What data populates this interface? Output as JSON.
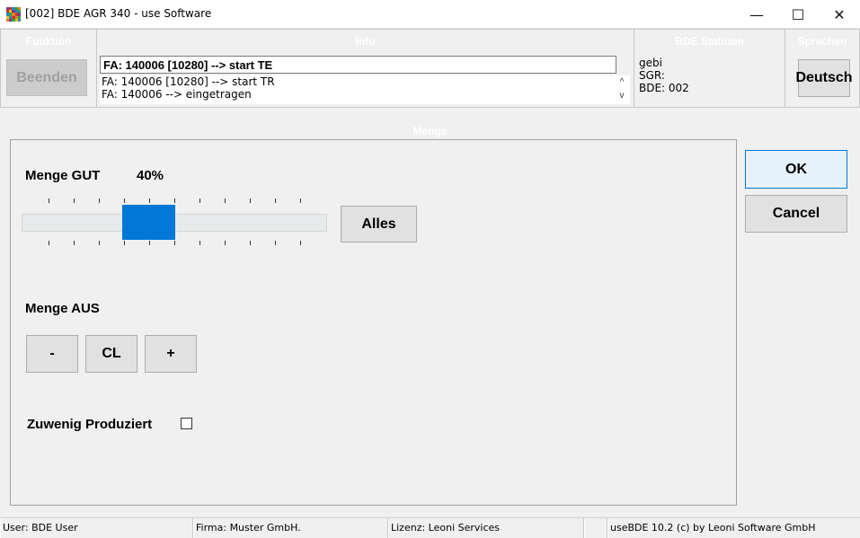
{
  "window": {
    "title": "[002] BDE AGR 340 - use Software",
    "minimize_glyph": "—",
    "maximize_glyph": "☐",
    "close_glyph": "✕"
  },
  "panels": {
    "funktion": {
      "title": "Funktion",
      "beenden_label": "Beenden"
    },
    "info": {
      "title": "Info",
      "current": "FA: 140006 [10280] --> start TE",
      "lines": [
        "FA: 140006 [10280] --> start TR",
        "FA: 140006 --> eingetragen"
      ],
      "scroll_up": "^",
      "scroll_down": "v"
    },
    "station": {
      "title": "BDE Statinon",
      "line1": "gebi",
      "line2": "SGR:",
      "line3": "BDE: 002"
    },
    "sprachen": {
      "title": "Sprachen",
      "language_label": "Deutsch"
    }
  },
  "menge": {
    "section_title": "Menge",
    "gut_label": "Menge GUT",
    "gut_percent": "40%",
    "gut_level": 0.4,
    "alles_label": "Alles",
    "aus_label": "Menge AUS",
    "minus_label": "-",
    "cl_label": "CL",
    "plus_label": "+",
    "zuwenig_label": "Zuwenig Produziert",
    "zuwenig_checked": false
  },
  "actions": {
    "ok_label": "OK",
    "cancel_label": "Cancel"
  },
  "status": {
    "user": "User: BDE User",
    "firma": "Firma: Muster GmbH.",
    "lizenz": "Lizenz: Leoni Services",
    "empty": "",
    "version": "useBDE 10.2 (c) by Leoni Software GmbH"
  },
  "colors": {
    "accent": "#0078d7",
    "panel_title": "#ffffff",
    "ok_border": "#0078d7"
  }
}
